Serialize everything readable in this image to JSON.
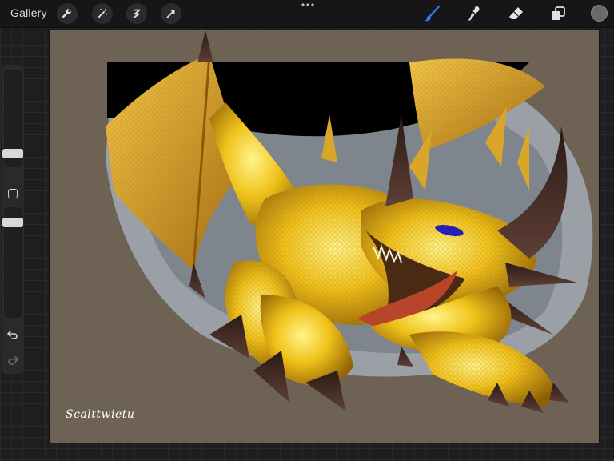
{
  "topbar": {
    "gallery_label": "Gallery",
    "left_tools": [
      "wrench-icon",
      "magic-wand-icon",
      "selection-icon",
      "transform-arrow-icon"
    ],
    "right_tools": [
      "brush-icon",
      "smudge-icon",
      "eraser-icon",
      "layers-icon"
    ],
    "active_tool": "brush-icon",
    "accent_color": "#2f7df6",
    "current_color": "#6a6a6a"
  },
  "canvas": {
    "signature_text": "Scalttwietu",
    "background_color": "#6e6255",
    "subject": "golden dragon"
  },
  "sidebar": {
    "brush_size_level": 0.45,
    "opacity_level": 0.6,
    "controls": [
      "brush-size-slider",
      "modify-button",
      "opacity-slider",
      "undo-icon",
      "redo-icon"
    ]
  }
}
